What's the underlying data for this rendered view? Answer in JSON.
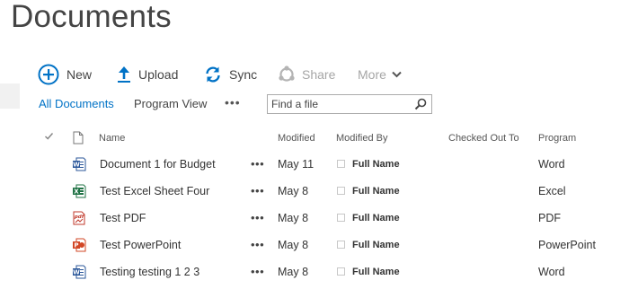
{
  "page": {
    "title": "Documents"
  },
  "commands": {
    "new": "New",
    "upload": "Upload",
    "sync": "Sync",
    "share": "Share",
    "more": "More"
  },
  "views": {
    "all_documents": "All Documents",
    "program_view": "Program View",
    "ellipsis": "•••"
  },
  "search": {
    "placeholder": "Find a file"
  },
  "columns": {
    "name": "Name",
    "modified": "Modified",
    "modified_by": "Modified By",
    "checked_out_to": "Checked Out To",
    "program": "Program"
  },
  "rows": [
    {
      "name": "Document 1 for Budget",
      "dots": "•••",
      "modified": "May 11",
      "modified_by": "Full Name",
      "program": "Word",
      "icon": "word-icon"
    },
    {
      "name": "Test Excel Sheet Four",
      "dots": "•••",
      "modified": "May 8",
      "modified_by": "Full Name",
      "program": "Excel",
      "icon": "excel-icon"
    },
    {
      "name": "Test PDF",
      "dots": "•••",
      "modified": "May 8",
      "modified_by": "Full Name",
      "program": "PDF",
      "icon": "pdf-icon"
    },
    {
      "name": "Test PowerPoint",
      "dots": "•••",
      "modified": "May 8",
      "modified_by": "Full Name",
      "program": "PowerPoint",
      "icon": "powerpoint-icon"
    },
    {
      "name": "Testing testing 1 2 3",
      "dots": "•••",
      "modified": "May 8",
      "modified_by": "Full Name",
      "program": "Word",
      "icon": "word-icon"
    }
  ],
  "colors": {
    "accent": "#0072c6",
    "word": "#2b579a",
    "excel": "#217346",
    "pdf": "#c0392b",
    "powerpoint": "#d24726",
    "disabled": "#a6a6a6"
  }
}
